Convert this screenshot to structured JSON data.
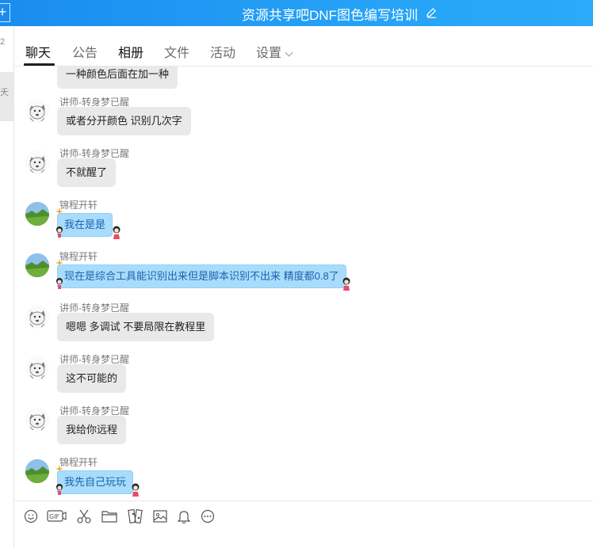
{
  "window": {
    "title": "资源共享吧DNF图色编写培训",
    "plus": "+"
  },
  "leftstrip": {
    "c1": "2",
    "c2": "夭"
  },
  "tabs": [
    {
      "label": "聊天"
    },
    {
      "label": "公告"
    },
    {
      "label": "相册"
    },
    {
      "label": "文件"
    },
    {
      "label": "活动"
    },
    {
      "label": "设置"
    }
  ],
  "messages": [
    {
      "sender": "",
      "text": "一种颜色后面在加一种",
      "avatar": "dog-icon",
      "style": "gray"
    },
    {
      "sender": "讲师-转身梦已醒",
      "text": "或者分开颜色 识别几次字",
      "avatar": "dog-icon",
      "style": "gray"
    },
    {
      "sender": "讲师-转身梦已醒",
      "text": "不就醒了",
      "avatar": "dog-icon",
      "style": "gray"
    },
    {
      "sender": "锦程开轩",
      "text": "我在是是",
      "avatar": "landscape-icon",
      "style": "blue"
    },
    {
      "sender": "锦程开轩",
      "text": "现在是综合工具能识别出来但是脚本识别不出来 精度都0.8了",
      "avatar": "landscape-icon",
      "style": "blue"
    },
    {
      "sender": "讲师-转身梦已醒",
      "text": "嗯嗯 多调试 不要局限在教程里",
      "avatar": "dog-icon",
      "style": "gray"
    },
    {
      "sender": "讲师-转身梦已醒",
      "text": "这不可能的",
      "avatar": "dog-icon",
      "style": "gray"
    },
    {
      "sender": "讲师-转身梦已醒",
      "text": "我给你远程",
      "avatar": "dog-icon",
      "style": "gray"
    },
    {
      "sender": "锦程开轩",
      "text": "我先自己玩玩",
      "avatar": "landscape-icon",
      "style": "blue"
    }
  ],
  "toolbar": {
    "icons": [
      "emoji-icon",
      "gif-icon",
      "scissors-icon",
      "folder-icon",
      "sticker-icon",
      "image-icon",
      "bell-icon",
      "more-icon"
    ],
    "gif_label": "GIF"
  },
  "colors": {
    "titlebar": "#1a8cf0",
    "bubble_gray": "#e9e9e9",
    "bubble_blue": "#a9dcfb",
    "bubble_blue_text": "#1b63b0"
  }
}
